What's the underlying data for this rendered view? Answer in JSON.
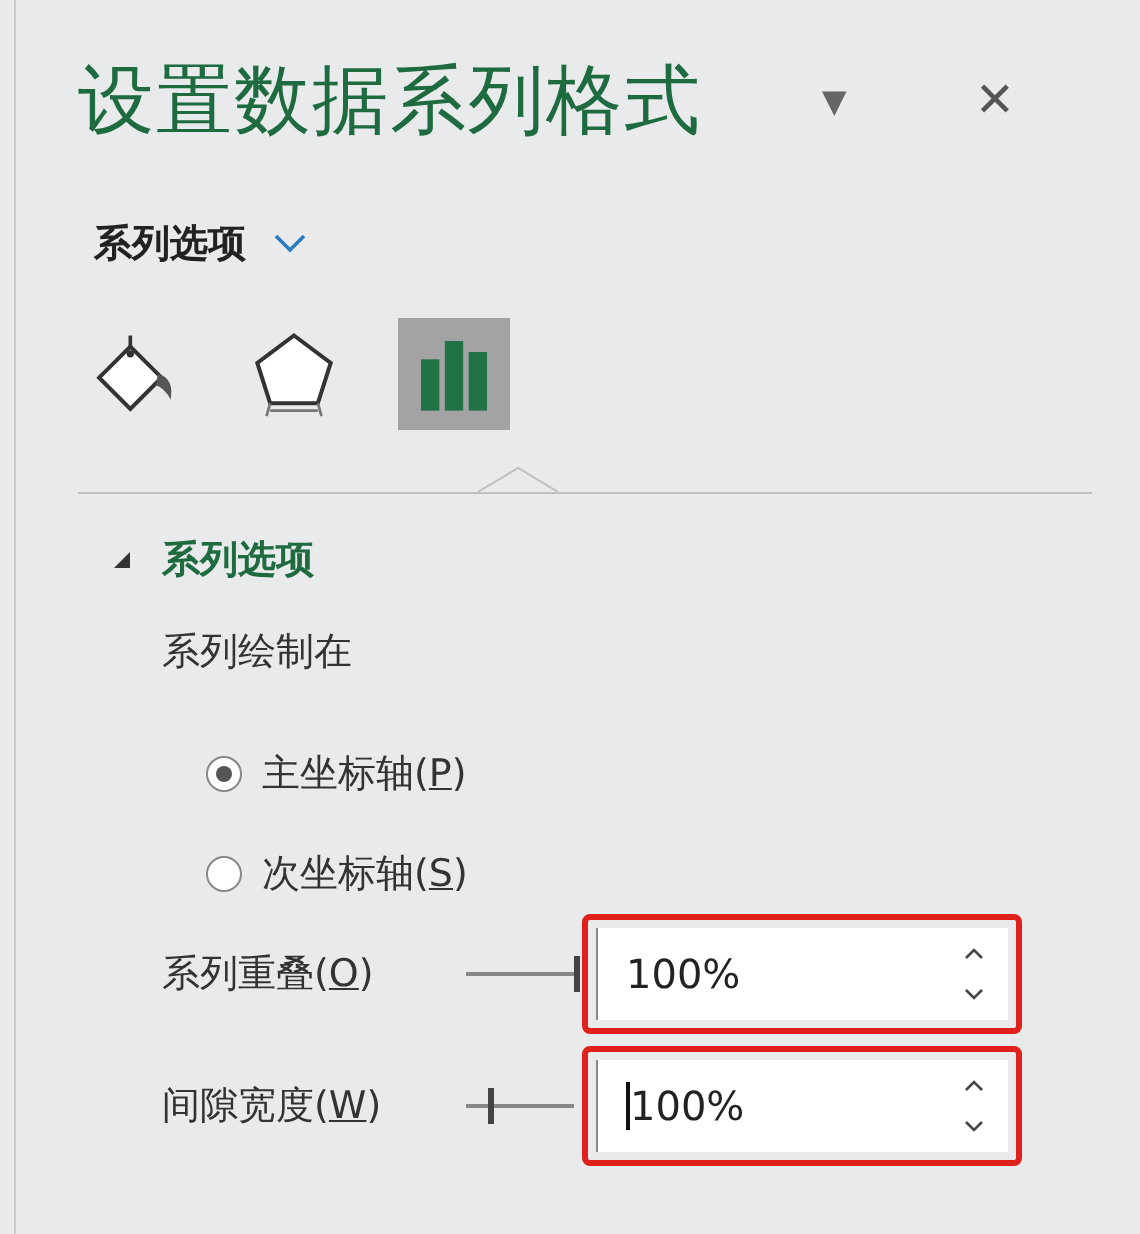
{
  "pane": {
    "title": "设置数据系列格式",
    "menu_glyph": "▼",
    "close_glyph": "✕"
  },
  "options_menu": {
    "label": "系列选项"
  },
  "tabs": [
    {
      "kind": "fill",
      "selected": false
    },
    {
      "kind": "effects",
      "selected": false
    },
    {
      "kind": "series",
      "selected": true
    }
  ],
  "section": {
    "title": "系列选项",
    "expanded": true,
    "plot_on_label": "系列绘制在",
    "axis_options": [
      {
        "before": "主坐标轴(",
        "hotkey": "P",
        "after": ")",
        "selected": true
      },
      {
        "before": "次坐标轴(",
        "hotkey": "S",
        "after": ")",
        "selected": false
      }
    ],
    "spinners": [
      {
        "before": "系列重叠(",
        "hotkey": "O",
        "after": ")",
        "level": 1,
        "value": "100%",
        "caret": false,
        "highlighted": true
      },
      {
        "before": "间隙宽度(",
        "hotkey": "W",
        "after": ")",
        "level": 0.2,
        "value": "100%",
        "caret": true,
        "highlighted": true
      }
    ]
  }
}
